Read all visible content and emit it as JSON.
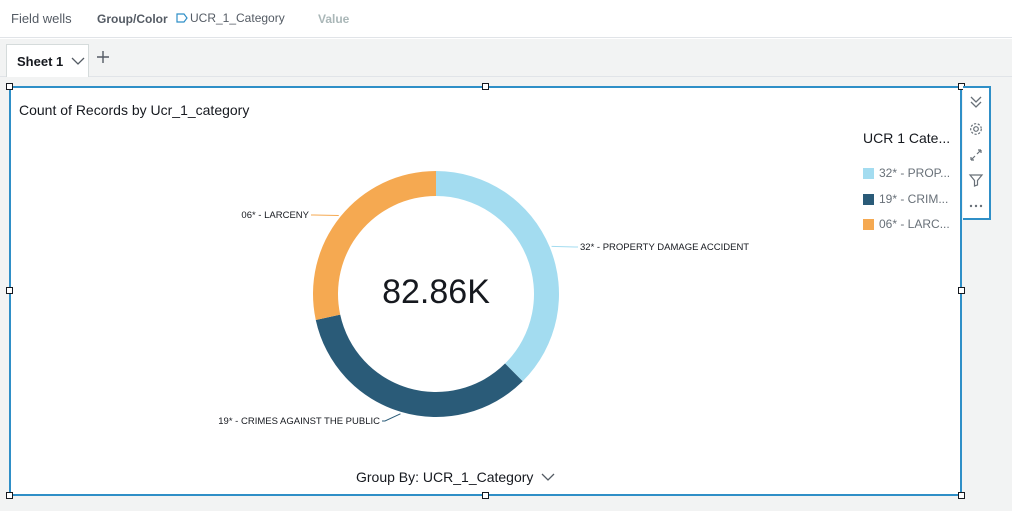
{
  "field_wells": {
    "title": "Field wells",
    "group_color_label": "Group/Color",
    "group_color_field": "UCR_1_Category",
    "value_label": "Value"
  },
  "sheets": {
    "tabs": [
      {
        "label": "Sheet 1"
      }
    ]
  },
  "visual": {
    "title": "Count of Records by Ucr_1_category",
    "total_label": "82.86K",
    "group_by_label": "Group By: UCR_1_Category"
  },
  "legend": {
    "title": "UCR 1 Cate...",
    "items": [
      {
        "label": "32* - PROP...",
        "color": "#a3dcf0"
      },
      {
        "label": "19* - CRIM...",
        "color": "#2a5b78"
      },
      {
        "label": "06* - LARC...",
        "color": "#f5a951"
      }
    ]
  },
  "chart_data": {
    "type": "pie",
    "title": "Count of Records by Ucr_1_category",
    "total": "82.86K",
    "categories": [
      "32* - PROPERTY DAMAGE ACCIDENT",
      "19* - CRIMES AGAINST THE PUBLIC",
      "06* - LARCENY"
    ],
    "values": [
      31.1,
      28.2,
      23.5
    ],
    "colors": [
      "#a3dcf0",
      "#2a5b78",
      "#f5a951"
    ],
    "legend": "right",
    "legend_title": "UCR 1 Cate..."
  }
}
